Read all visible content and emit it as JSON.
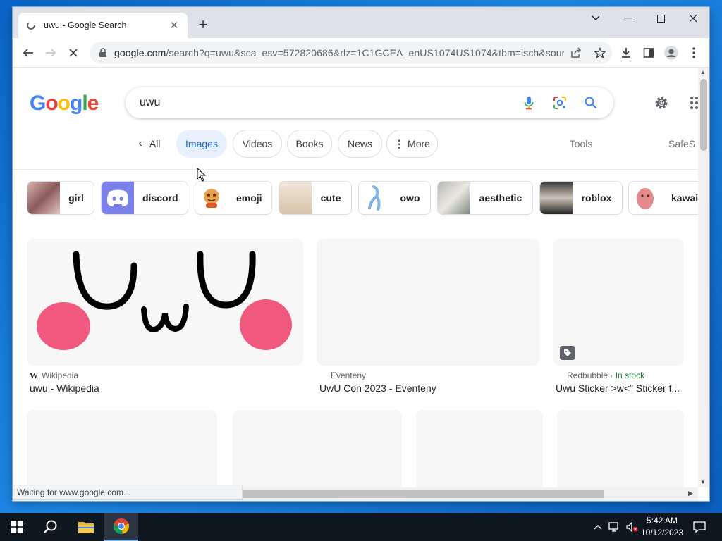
{
  "browser": {
    "tab_title": "uwu - Google Search",
    "url_host": "google.com",
    "url_rest": "/search?q=uwu&sca_esv=572820686&rlz=1C1GCEA_enUS1074US1074&tbm=isch&sourc...",
    "status_text": "Waiting for www.google.com..."
  },
  "google": {
    "logo": [
      "G",
      "o",
      "o",
      "g",
      "l",
      "e"
    ],
    "logo_colors": [
      "#4285F4",
      "#EA4335",
      "#FBBC05",
      "#4285F4",
      "#34A853",
      "#EA4335"
    ],
    "query": "uwu",
    "filters": {
      "back_all": "All",
      "images": "Images",
      "videos": "Videos",
      "books": "Books",
      "news": "News",
      "more": "More",
      "tools": "Tools",
      "safesearch": "SafeS"
    },
    "chips": [
      {
        "label": "girl"
      },
      {
        "label": "discord"
      },
      {
        "label": "emoji"
      },
      {
        "label": "cute"
      },
      {
        "label": "owo"
      },
      {
        "label": "aesthetic"
      },
      {
        "label": "roblox"
      },
      {
        "label": "kawaii"
      }
    ],
    "results": [
      {
        "source": "Wikipedia",
        "title": "uwu - Wikipedia"
      },
      {
        "source": "Eventeny",
        "title": "UwU Con 2023 - Eventeny"
      },
      {
        "source": "Redbubble",
        "source_extra": " · In stock",
        "title": "Uwu Sticker >w<\" Sticker f..."
      }
    ]
  },
  "taskbar": {
    "time": "5:42 AM",
    "date": "10/12/2023"
  },
  "colors": {
    "accent": "#1a73e8",
    "active_chip_bg": "#e8f0fe",
    "blush": "#f0587e"
  }
}
